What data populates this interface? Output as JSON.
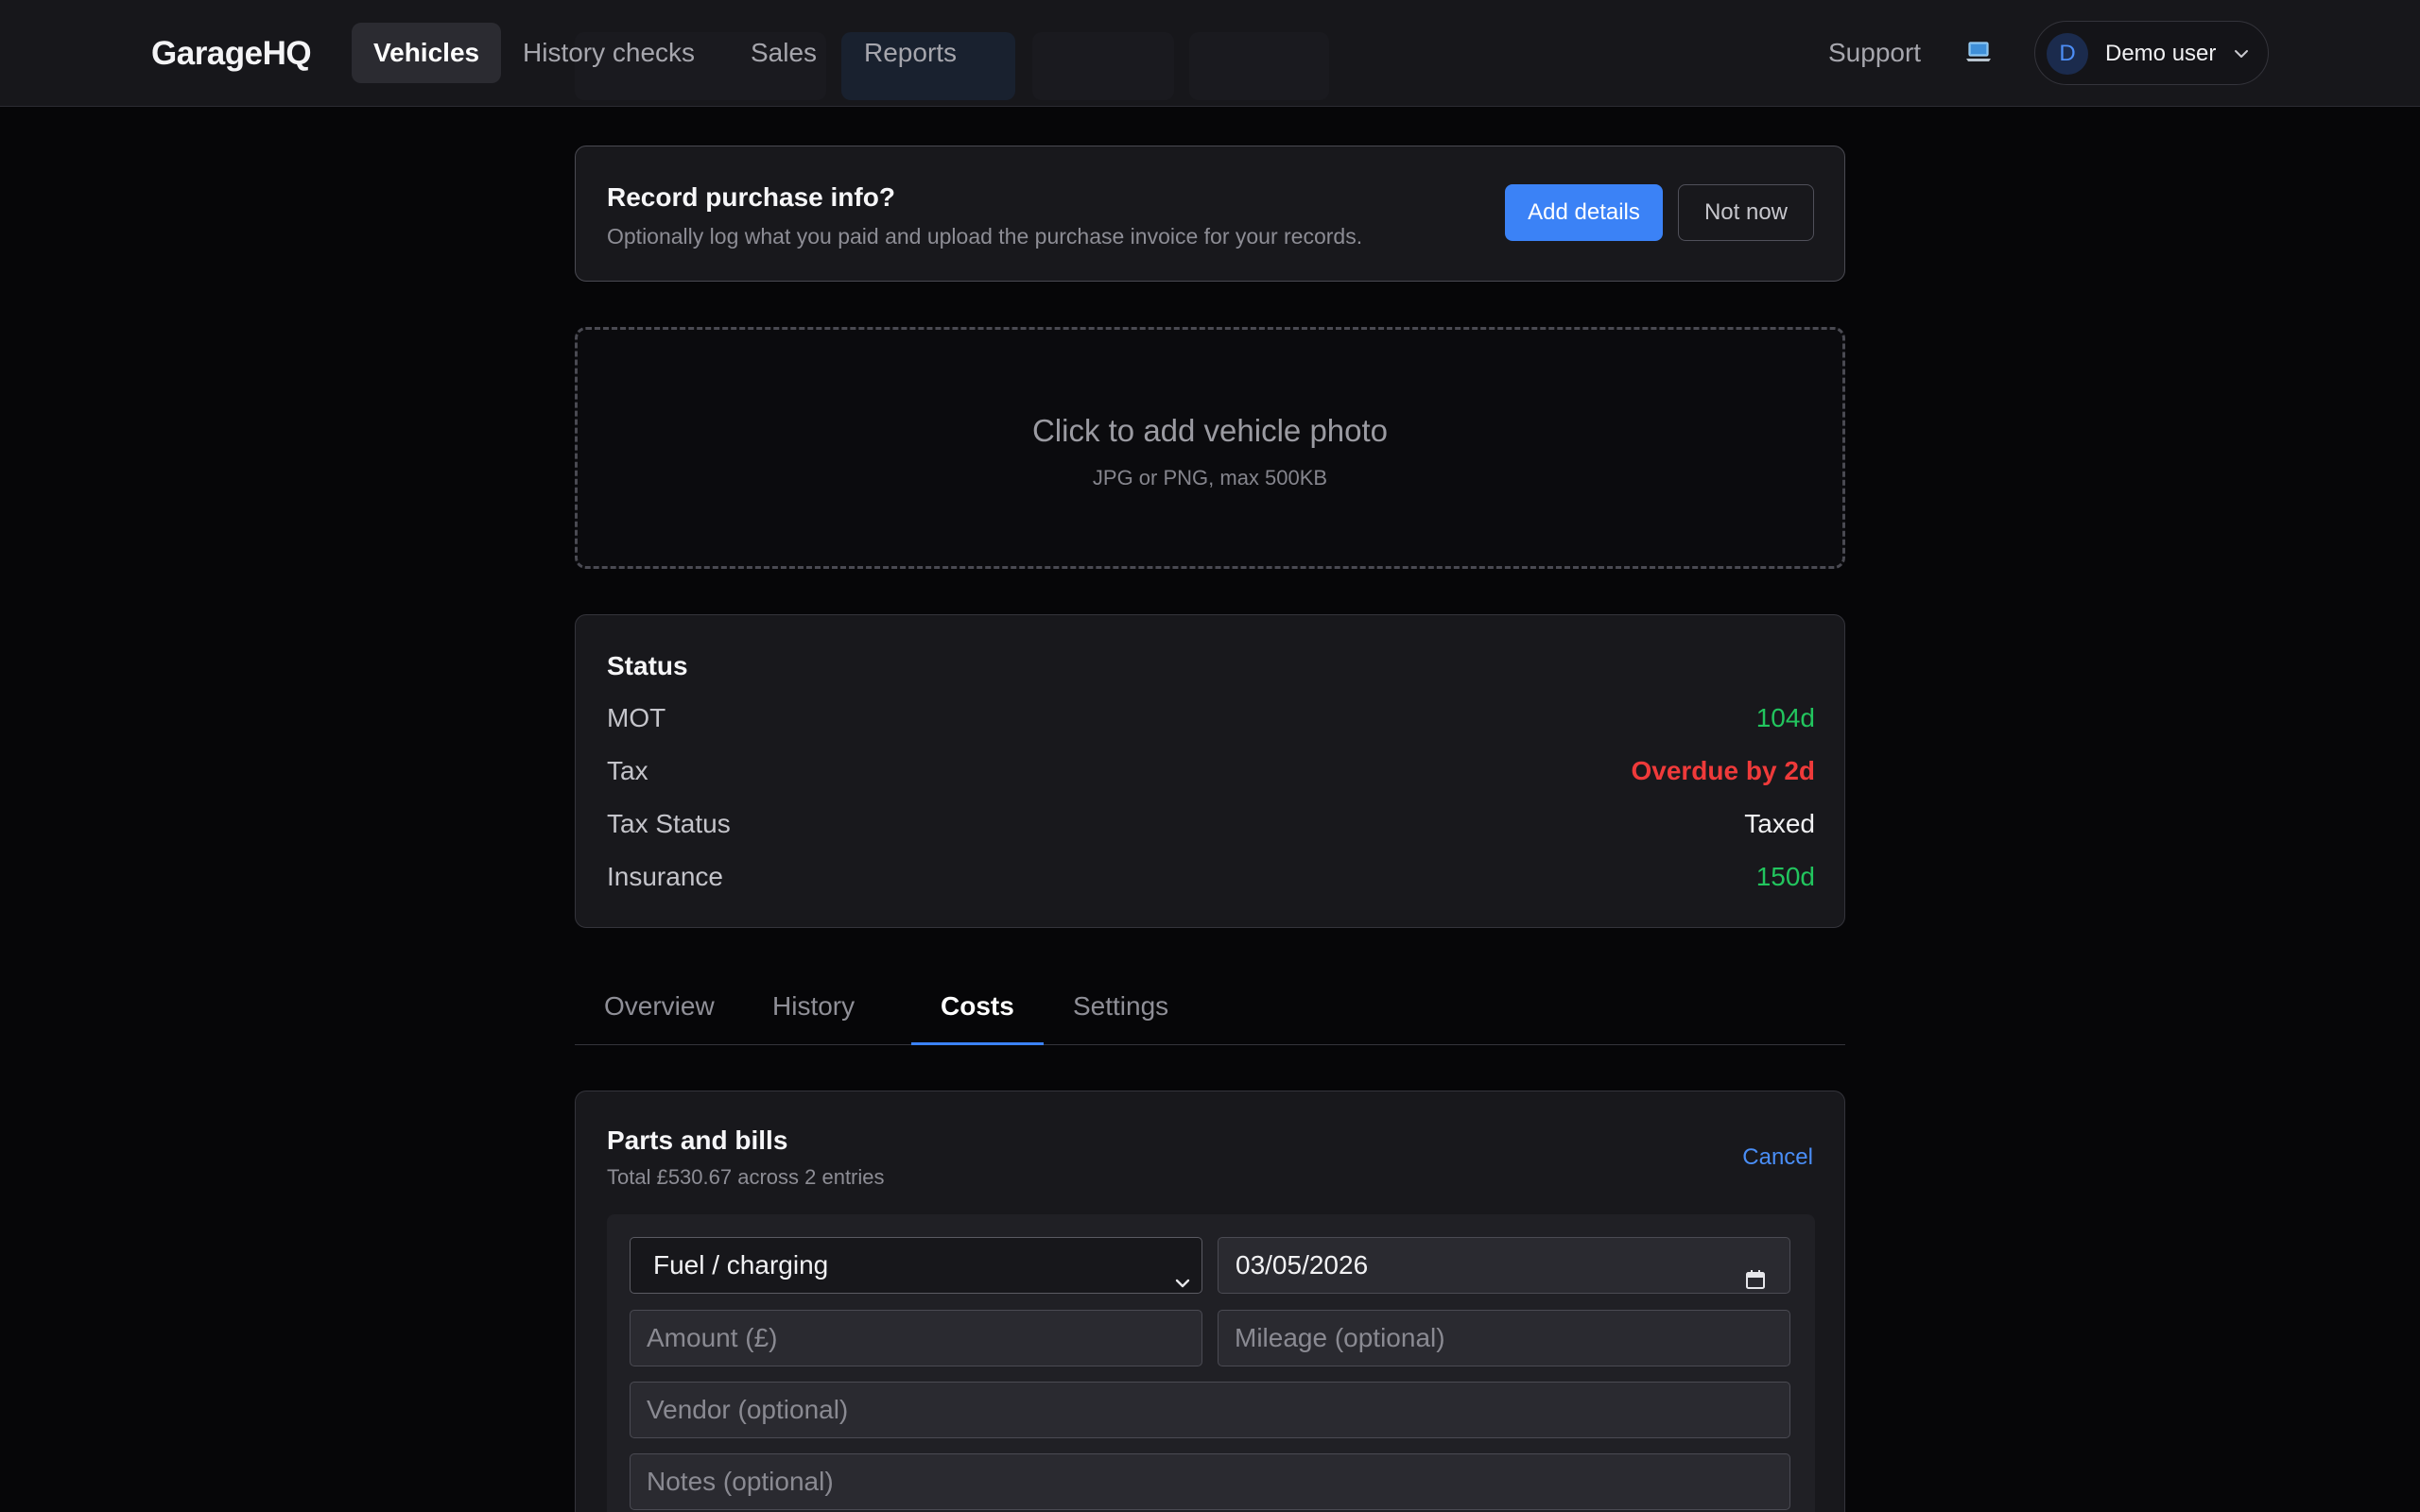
{
  "nav": {
    "brand": "GarageHQ",
    "links": [
      {
        "label": "Vehicles",
        "active": true
      },
      {
        "label": "History checks",
        "active": false
      },
      {
        "label": "Sales",
        "active": false
      },
      {
        "label": "Reports",
        "active": false
      }
    ],
    "support": "Support",
    "device_icon": "laptop-icon",
    "user": {
      "initial": "D",
      "name": "Demo user"
    }
  },
  "purchase_prompt": {
    "title": "Record purchase info?",
    "subtitle": "Optionally log what you paid and upload the purchase invoice for your records.",
    "primary_button": "Add details",
    "secondary_button": "Not now"
  },
  "photo_upload": {
    "title": "Click to add vehicle photo",
    "hint": "JPG or PNG, max 500KB"
  },
  "status": {
    "title": "Status",
    "rows": [
      {
        "label": "MOT",
        "value": "104d",
        "color": "#22c55e"
      },
      {
        "label": "Tax",
        "value": "Overdue by 2d",
        "color": "#ef3a3a"
      },
      {
        "label": "Tax Status",
        "value": "Taxed",
        "color": "#f2f2f4"
      },
      {
        "label": "Insurance",
        "value": "150d",
        "color": "#22c55e"
      }
    ]
  },
  "tabs": [
    {
      "label": "Overview",
      "active": false
    },
    {
      "label": "History",
      "active": false
    },
    {
      "label": "Costs",
      "active": true
    },
    {
      "label": "Settings",
      "active": false
    }
  ],
  "costs": {
    "title": "Parts and bills",
    "summary": "Total £530.67 across 2 entries",
    "cancel": "Cancel",
    "form": {
      "category_selected": "Fuel / charging",
      "date_value": "03/05/2026",
      "amount_placeholder": "Amount (£)",
      "mileage_placeholder": "Mileage (optional)",
      "vendor_placeholder": "Vendor (optional)",
      "notes_placeholder": "Notes (optional)"
    }
  },
  "colors": {
    "accent": "#3b82f6",
    "ok": "#22c55e",
    "danger": "#ef3a3a"
  }
}
